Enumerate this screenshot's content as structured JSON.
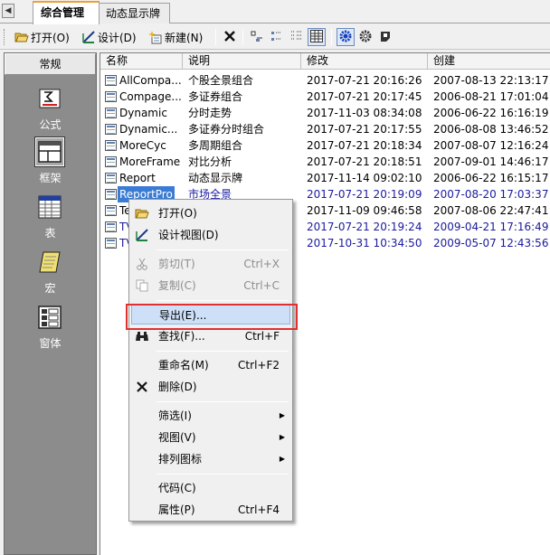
{
  "tabs": [
    {
      "label": "综合管理",
      "active": true
    },
    {
      "label": "动态显示牌",
      "active": false
    }
  ],
  "toolbar": {
    "open_label": "打开(O)",
    "design_label": "设计(D)",
    "new_label": "新建(N)"
  },
  "sidebar": {
    "header": "常规",
    "items": [
      {
        "label": "公式",
        "icon": "formula-icon"
      },
      {
        "label": "框架",
        "icon": "frame-icon",
        "selected": true
      },
      {
        "label": "表",
        "icon": "table-icon"
      },
      {
        "label": "宏",
        "icon": "macro-icon"
      },
      {
        "label": "窗体",
        "icon": "form-icon"
      }
    ]
  },
  "list": {
    "columns": [
      "名称",
      "说明",
      "修改",
      "创建"
    ],
    "rows": [
      {
        "name": "AllCompa...",
        "desc": "个股全景组合",
        "modified": "2017-07-21 20:16:26",
        "created": "2007-08-13 22:13:17"
      },
      {
        "name": "Compage...",
        "desc": "多证券组合",
        "modified": "2017-07-21 20:17:45",
        "created": "2006-08-21 17:01:04"
      },
      {
        "name": "Dynamic",
        "desc": "分时走势",
        "modified": "2017-11-03 08:34:08",
        "created": "2006-06-22 16:16:19"
      },
      {
        "name": "Dynamic...",
        "desc": "多证券分时组合",
        "modified": "2017-07-21 20:17:55",
        "created": "2006-08-08 13:46:52"
      },
      {
        "name": "MoreCyc",
        "desc": "多周期组合",
        "modified": "2017-07-21 20:18:34",
        "created": "2007-08-07 12:16:24"
      },
      {
        "name": "MoreFrame",
        "desc": "对比分析",
        "modified": "2017-07-21 20:18:51",
        "created": "2007-09-01 14:46:17"
      },
      {
        "name": "Report",
        "desc": "动态显示牌",
        "modified": "2017-11-14 09:02:10",
        "created": "2006-06-22 16:15:17"
      },
      {
        "name": "ReportPro",
        "desc": "市场全景",
        "modified": "2017-07-21 20:19:09",
        "created": "2007-08-20 17:03:37"
      },
      {
        "name": "Te",
        "desc": "",
        "modified": "2017-11-09 09:46:58",
        "created": "2007-08-06 22:47:41"
      },
      {
        "name": "TV",
        "desc": "",
        "modified": "2017-07-21 20:19:24",
        "created": "2009-04-21 17:16:49"
      },
      {
        "name": "TV",
        "desc": "",
        "modified": "2017-10-31 10:34:50",
        "created": "2009-05-07 12:43:56"
      }
    ]
  },
  "context_menu": {
    "open": "打开(O)",
    "design_view": "设计视图(D)",
    "cut": "剪切(T)",
    "cut_key": "Ctrl+X",
    "copy": "复制(C)",
    "copy_key": "Ctrl+C",
    "export": "导出(E)...",
    "find": "查找(F)...",
    "find_key": "Ctrl+F",
    "rename": "重命名(M)",
    "rename_key": "Ctrl+F2",
    "delete": "删除(D)",
    "filter": "筛选(I)",
    "view": "视图(V)",
    "arrange": "排列图标",
    "code": "代码(C)",
    "properties": "属性(P)",
    "properties_key": "Ctrl+F4"
  },
  "colors": {
    "highlight_border": "#e03030",
    "selection": "#3a7bd5",
    "blue_text": "#1a1aa0"
  }
}
